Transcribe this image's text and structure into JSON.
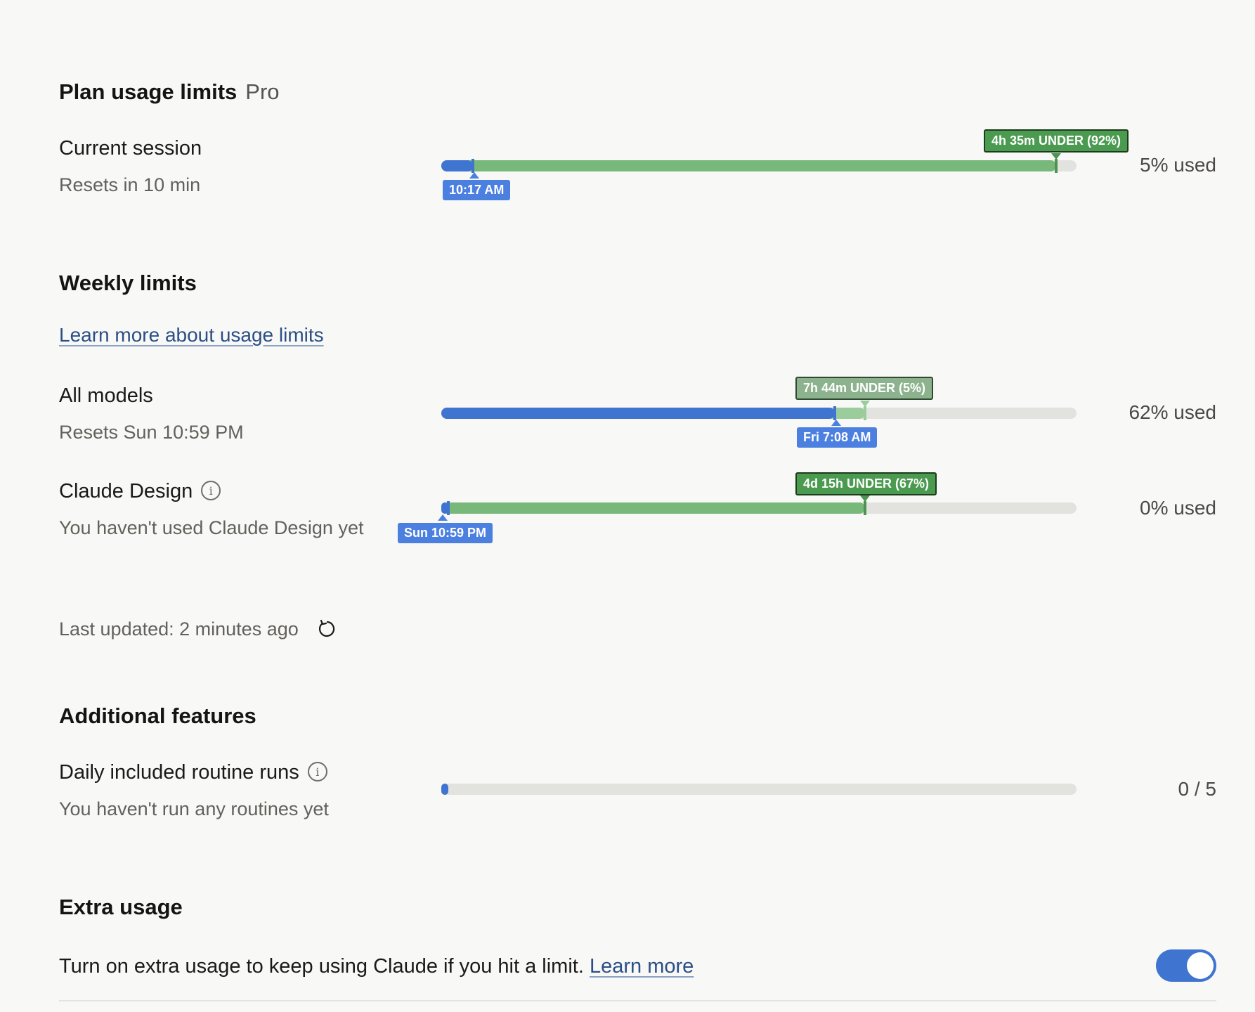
{
  "plan": {
    "title": "Plan usage limits",
    "badge": "Pro"
  },
  "current_session": {
    "label": "Current session",
    "reset": "Resets in 10 min",
    "used_text": "5% used",
    "used_fraction": 0.05,
    "pace_fraction": 0.968,
    "pace_tag": "4h 35m UNDER (92%)",
    "time_tag": "10:17 AM"
  },
  "weekly": {
    "title": "Weekly limits",
    "learn_more": "Learn more about usage limits",
    "all_models": {
      "label": "All models",
      "reset": "Resets Sun 10:59 PM",
      "used_text": "62% used",
      "used_fraction": 0.62,
      "pace_fraction": 0.667,
      "pace_tag": "7h 44m UNDER (5%)",
      "time_tag": "Fri 7:08 AM"
    },
    "claude_design": {
      "label": "Claude Design",
      "note": "You haven't used Claude Design yet",
      "used_text": "0% used",
      "used_fraction": 0.0,
      "pace_fraction": 0.667,
      "pace_tag": "4d 15h UNDER (67%)",
      "time_tag": "Sun 10:59 PM"
    }
  },
  "last_updated": "Last updated: 2 minutes ago",
  "additional": {
    "title": "Additional features",
    "routines": {
      "label": "Daily included routine runs",
      "note": "You haven't run any routines yet",
      "count": "0 / 5",
      "used_fraction": 0.0
    }
  },
  "extra": {
    "title": "Extra usage",
    "text": "Turn on extra usage to keep using Claude if you hit a limit.",
    "learn_more": "Learn more",
    "enabled": true
  },
  "colors": {
    "accent_blue": "#3f74d0",
    "pace_green": "#78b87a",
    "track": "#e2e2df"
  }
}
